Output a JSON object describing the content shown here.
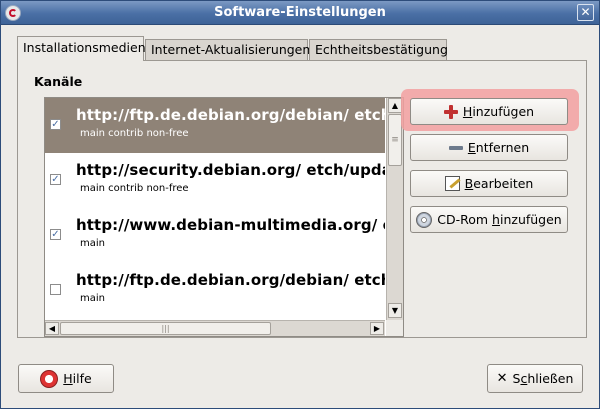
{
  "window": {
    "title": "Software-Einstellungen",
    "close_glyph": "✕",
    "menu_icon": "debian-swirl-icon"
  },
  "tabs": [
    {
      "label": "Installationsmedien",
      "active": true
    },
    {
      "label": "Internet-Aktualisierungen",
      "active": false
    },
    {
      "label": "Echtheitsbestätigung",
      "active": false
    }
  ],
  "channels": {
    "label": "Kanäle",
    "rows": [
      {
        "uri": "http://ftp.de.debian.org/debian/ etch",
        "components": "main contrib non-free",
        "checked": true,
        "selected": true
      },
      {
        "uri": "http://security.debian.org/ etch/updates",
        "components": "main contrib non-free",
        "checked": true,
        "selected": false
      },
      {
        "uri": "http://www.debian-multimedia.org/ etch",
        "components": "main",
        "checked": true,
        "selected": false
      },
      {
        "uri": "http://ftp.de.debian.org/debian/ etch",
        "components": "main",
        "checked": false,
        "selected": false
      }
    ]
  },
  "buttons": {
    "add": {
      "pre": "",
      "mnemonic": "H",
      "post": "inzufügen",
      "icon": "add-icon"
    },
    "remove": {
      "pre": "",
      "mnemonic": "E",
      "post": "ntfernen",
      "icon": "remove-icon"
    },
    "edit": {
      "pre": "",
      "mnemonic": "B",
      "post": "earbeiten",
      "icon": "edit-icon"
    },
    "cdrom": {
      "pre": "CD-Rom ",
      "mnemonic": "h",
      "post": "inzufügen",
      "icon": "cdrom-icon"
    },
    "help": {
      "pre": "",
      "mnemonic": "H",
      "post": "ilfe",
      "icon": "help-icon"
    },
    "close": {
      "pre": "S",
      "mnemonic": "c",
      "post": "hließen",
      "icon": "close-icon"
    }
  },
  "scrollbars": {
    "up": "▲",
    "down": "▼",
    "left": "◀",
    "right": "▶",
    "grip_v": "≡",
    "grip_h": "|||"
  },
  "check_glyph": "✓",
  "colors": {
    "titlebar": "#4a6fa5",
    "selected_row": "#8f8377",
    "focus_highlight": "#f2a0a0",
    "add_icon": "#c03030"
  }
}
